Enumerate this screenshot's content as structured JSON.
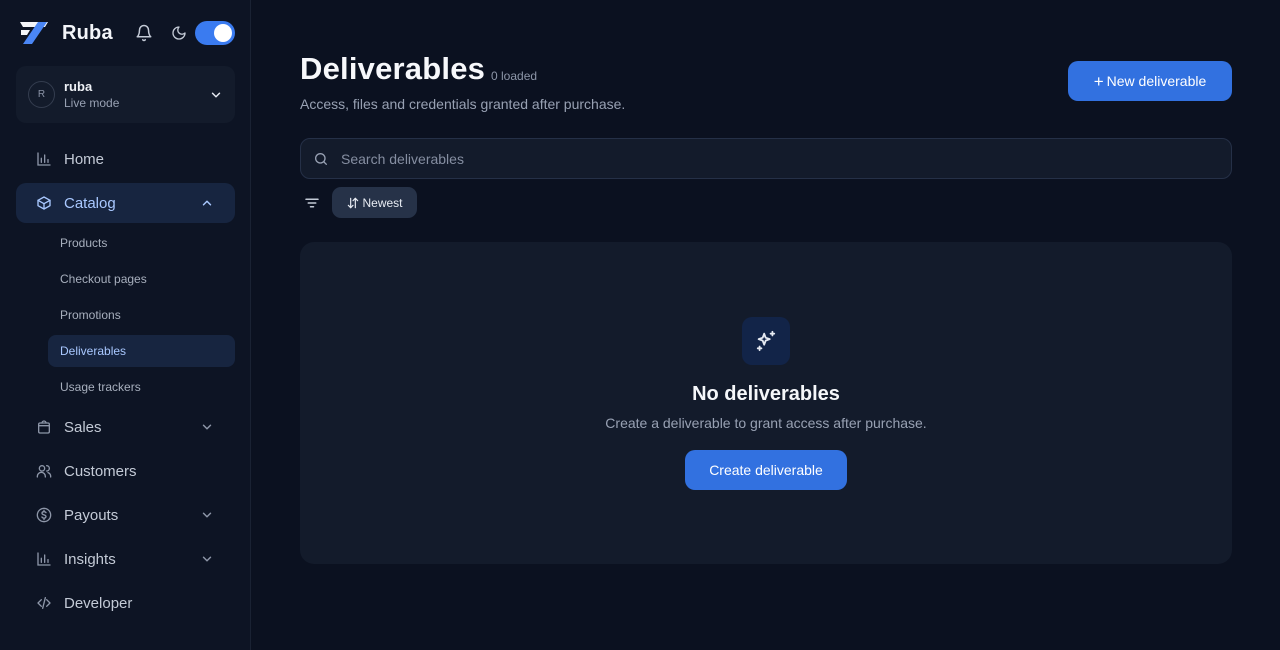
{
  "app": {
    "name": "Ruba"
  },
  "account": {
    "initial": "R",
    "name": "ruba",
    "mode": "Live mode"
  },
  "sidebar": {
    "items": [
      {
        "label": "Home",
        "icon": "bar-chart-icon"
      },
      {
        "label": "Catalog",
        "icon": "box-icon",
        "expanded": true
      },
      {
        "label": "Sales",
        "icon": "shopping-bag-icon"
      },
      {
        "label": "Customers",
        "icon": "users-icon"
      },
      {
        "label": "Payouts",
        "icon": "dollar-circle-icon"
      },
      {
        "label": "Insights",
        "icon": "bar-chart-icon"
      },
      {
        "label": "Developer",
        "icon": "code-icon"
      }
    ],
    "catalog_sub": [
      {
        "label": "Products"
      },
      {
        "label": "Checkout pages"
      },
      {
        "label": "Promotions"
      },
      {
        "label": "Deliverables",
        "active": true
      },
      {
        "label": "Usage trackers"
      }
    ]
  },
  "header": {
    "title": "Deliverables",
    "count_text": "0 loaded",
    "subtitle": "Access, files and credentials granted after purchase.",
    "new_button": "New deliverable"
  },
  "search": {
    "placeholder": "Search deliverables",
    "value": ""
  },
  "sort": {
    "label": "Newest"
  },
  "empty_state": {
    "title": "No deliverables",
    "description": "Create a deliverable to grant access after purchase.",
    "button": "Create deliverable",
    "icon": "sparkles-icon"
  },
  "colors": {
    "accent": "#3271e0",
    "background": "#0b1120",
    "card": "#131b2b",
    "active_nav": "#172540"
  }
}
